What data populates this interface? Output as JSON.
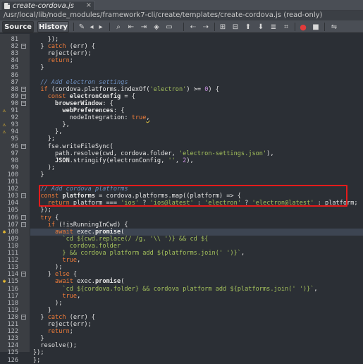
{
  "tab": {
    "title": "create-cordova.js",
    "close": "×"
  },
  "path": "/usr/local/lib/node_modules/framework7-cli/create/templates/create-cordova.js (read-only)",
  "toolbar": {
    "source_label": "Source",
    "history_label": "History",
    "icons": [
      "last-edit-icon",
      "back-icon",
      "forward-icon",
      "find-selection-icon",
      "find-previous-icon",
      "find-next-icon",
      "toggle-highlight-icon",
      "toggle-rectangular-icon",
      "shift-left-icon",
      "shift-right-icon",
      "comment-icon",
      "uncomment-icon",
      "record-macro-icon",
      "stop-macro-icon",
      "diff-icon"
    ]
  },
  "highlight_color": "#e41b1b",
  "lines": [
    {
      "n": "81",
      "t": [
        [
          "    });",
          ""
        ]
      ]
    },
    {
      "n": "82",
      "t": [
        [
          "  } ",
          ""
        ],
        [
          "catch",
          "kw"
        ],
        [
          " (err) {",
          ""
        ]
      ],
      "fold": "-"
    },
    {
      "n": "83",
      "t": [
        [
          "    reject(err);",
          ""
        ]
      ]
    },
    {
      "n": "84",
      "t": [
        [
          "    ",
          ""
        ],
        [
          "return",
          "kw"
        ],
        [
          ";",
          ""
        ]
      ]
    },
    {
      "n": "85",
      "t": [
        [
          "  }",
          ""
        ]
      ]
    },
    {
      "n": "86",
      "t": [
        [
          "",
          ""
        ]
      ]
    },
    {
      "n": "87",
      "t": [
        [
          "  // Add electron settings",
          "cm"
        ]
      ]
    },
    {
      "n": "88",
      "t": [
        [
          "  ",
          ""
        ],
        [
          "if",
          "kw"
        ],
        [
          " (cordova.platforms.indexOf(",
          ""
        ],
        [
          "'electron'",
          "str"
        ],
        [
          ") >= ",
          ""
        ],
        [
          "0",
          "num"
        ],
        [
          ") {",
          ""
        ]
      ],
      "fold": "-"
    },
    {
      "n": "89",
      "t": [
        [
          "    ",
          ""
        ],
        [
          "const",
          "kw"
        ],
        [
          " ",
          ""
        ],
        [
          "electronConfig",
          "fn"
        ],
        [
          " = {",
          ""
        ]
      ],
      "fold": "-"
    },
    {
      "n": "90",
      "t": [
        [
          "      ",
          ""
        ],
        [
          "browserWindow",
          "fn"
        ],
        [
          ": {",
          ""
        ]
      ],
      "fold": "-"
    },
    {
      "n": "91",
      "t": [
        [
          "        ",
          ""
        ],
        [
          "webPreferences",
          "fn"
        ],
        [
          ": {",
          ""
        ]
      ],
      "marker": "warn"
    },
    {
      "n": "92",
      "t": [
        [
          "          nodeIntegration: ",
          ""
        ],
        [
          "true",
          "kw"
        ],
        [
          ",",
          "wavy"
        ]
      ]
    },
    {
      "n": "93",
      "t": [
        [
          "        },",
          ""
        ]
      ],
      "marker": "warn"
    },
    {
      "n": "94",
      "t": [
        [
          "      },",
          ""
        ]
      ],
      "marker": "warn"
    },
    {
      "n": "95",
      "t": [
        [
          "    };",
          ""
        ]
      ]
    },
    {
      "n": "96",
      "t": [
        [
          "    fse.writeFileSync(",
          ""
        ]
      ],
      "fold": "-"
    },
    {
      "n": "97",
      "t": [
        [
          "      path.resolve(cwd, cordova.folder, ",
          ""
        ],
        [
          "'electron-settings.json'",
          "str"
        ],
        [
          "),",
          ""
        ]
      ]
    },
    {
      "n": "98",
      "t": [
        [
          "      ",
          ""
        ],
        [
          "JSON",
          "fn"
        ],
        [
          ".stringify(electronConfig, ",
          ""
        ],
        [
          "''",
          "str"
        ],
        [
          ", ",
          ""
        ],
        [
          "2",
          "num"
        ],
        [
          "),",
          ""
        ]
      ]
    },
    {
      "n": "99",
      "t": [
        [
          "    );",
          ""
        ]
      ]
    },
    {
      "n": "100",
      "t": [
        [
          "  }",
          ""
        ]
      ]
    },
    {
      "n": "101",
      "t": [
        [
          "",
          ""
        ]
      ]
    },
    {
      "n": "102",
      "t": [
        [
          "  // Add cordova platforms",
          "cm"
        ]
      ]
    },
    {
      "n": "103",
      "t": [
        [
          "  ",
          ""
        ],
        [
          "const",
          "kw"
        ],
        [
          " ",
          ""
        ],
        [
          "platforms",
          "fn"
        ],
        [
          " = cordova.platforms.map((platform) => {",
          ""
        ]
      ],
      "fold": "-"
    },
    {
      "n": "104",
      "t": [
        [
          "    ",
          ""
        ],
        [
          "return",
          "kw"
        ],
        [
          " platform === ",
          ""
        ],
        [
          "'ios'",
          "str"
        ],
        [
          " ? ",
          ""
        ],
        [
          "'ios@latest'",
          "str"
        ],
        [
          " : ",
          ""
        ],
        [
          "'electron'",
          "str"
        ],
        [
          " ? ",
          ""
        ],
        [
          "'electron@latest'",
          "str"
        ],
        [
          " : platform;",
          ""
        ]
      ]
    },
    {
      "n": "105",
      "t": [
        [
          "  });",
          ""
        ]
      ]
    },
    {
      "n": "106",
      "t": [
        [
          "  ",
          ""
        ],
        [
          "try",
          "kw"
        ],
        [
          " {",
          ""
        ]
      ],
      "fold": "-"
    },
    {
      "n": "107",
      "t": [
        [
          "    ",
          ""
        ],
        [
          "if",
          "kw"
        ],
        [
          " (!isRunningInCwd) {",
          ""
        ]
      ],
      "fold": "-"
    },
    {
      "n": "108",
      "t": [
        [
          "      ",
          ""
        ],
        [
          "await",
          "kw"
        ],
        [
          " exec.",
          ""
        ],
        [
          "promise",
          "fn"
        ],
        [
          "(",
          ""
        ]
      ],
      "marker": "bulb",
      "hl": true
    },
    {
      "n": "109",
      "t": [
        [
          "        ",
          ""
        ],
        [
          "`cd ${cwd.replace(/ /g, '\\\\ ')} && cd ${",
          "str"
        ]
      ]
    },
    {
      "n": "110",
      "t": [
        [
          "          ",
          ""
        ],
        [
          "cordova.folder",
          "str"
        ]
      ]
    },
    {
      "n": "111",
      "t": [
        [
          "        ",
          ""
        ],
        [
          "} && cordova platform add ${platforms.join(' ')}`",
          "str"
        ],
        [
          ",",
          ""
        ]
      ]
    },
    {
      "n": "112",
      "t": [
        [
          "        ",
          ""
        ],
        [
          "true",
          "kw"
        ],
        [
          ",",
          ""
        ]
      ]
    },
    {
      "n": "113",
      "t": [
        [
          "      );",
          ""
        ]
      ]
    },
    {
      "n": "114",
      "t": [
        [
          "    } ",
          ""
        ],
        [
          "else",
          "kw"
        ],
        [
          " {",
          ""
        ]
      ],
      "fold": "-"
    },
    {
      "n": "115",
      "t": [
        [
          "      ",
          ""
        ],
        [
          "await",
          "kw"
        ],
        [
          " exec.",
          ""
        ],
        [
          "promise",
          "fn"
        ],
        [
          "(",
          ""
        ]
      ],
      "marker": "bulb"
    },
    {
      "n": "116",
      "t": [
        [
          "        ",
          ""
        ],
        [
          "`cd ${cordova.folder} && cordova platform add ${platforms.join(' ')}`",
          "str"
        ],
        [
          ",",
          ""
        ]
      ]
    },
    {
      "n": "117",
      "t": [
        [
          "        ",
          ""
        ],
        [
          "true",
          "kw"
        ],
        [
          ",",
          ""
        ]
      ]
    },
    {
      "n": "118",
      "t": [
        [
          "      );",
          ""
        ]
      ]
    },
    {
      "n": "119",
      "t": [
        [
          "    }",
          ""
        ]
      ]
    },
    {
      "n": "120",
      "t": [
        [
          "  } ",
          ""
        ],
        [
          "catch",
          "kw"
        ],
        [
          " (err) {",
          ""
        ]
      ],
      "fold": "-"
    },
    {
      "n": "121",
      "t": [
        [
          "    reject(err);",
          ""
        ]
      ]
    },
    {
      "n": "122",
      "t": [
        [
          "    ",
          ""
        ],
        [
          "return",
          "kw"
        ],
        [
          ";",
          ""
        ]
      ]
    },
    {
      "n": "123",
      "t": [
        [
          "  }",
          ""
        ]
      ]
    },
    {
      "n": "124",
      "t": [
        [
          "  resolve();",
          ""
        ]
      ]
    },
    {
      "n": "125",
      "t": [
        [
          "});",
          ""
        ]
      ]
    },
    {
      "n": "126",
      "t": [
        [
          "};",
          ""
        ]
      ]
    }
  ]
}
